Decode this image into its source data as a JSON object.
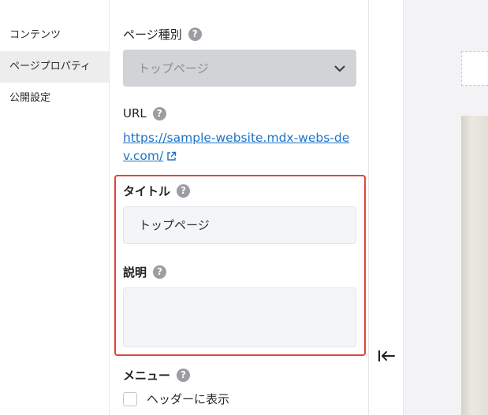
{
  "nav": {
    "items": [
      {
        "label": "コンテンツ",
        "active": false
      },
      {
        "label": "ページプロパティ",
        "active": true
      },
      {
        "label": "公開設定",
        "active": false
      }
    ]
  },
  "panel": {
    "page_type": {
      "label": "ページ種別",
      "selected": "トップページ"
    },
    "url": {
      "label": "URL",
      "value": "https://sample-website.mdx-webs-dev.com/"
    },
    "title": {
      "label": "タイトル",
      "value": "トップページ"
    },
    "description": {
      "label": "説明",
      "value": ""
    },
    "menu": {
      "label": "メニュー",
      "checkbox_label": "ヘッダーに表示",
      "checked": false
    }
  },
  "icons": {
    "help": "?"
  },
  "colors": {
    "link": "#1a73c9",
    "highlight_border": "#e0453c",
    "active_nav_bg": "#ededee",
    "help_icon_bg": "#9c9ca2",
    "select_bg": "#d2d3d6"
  }
}
